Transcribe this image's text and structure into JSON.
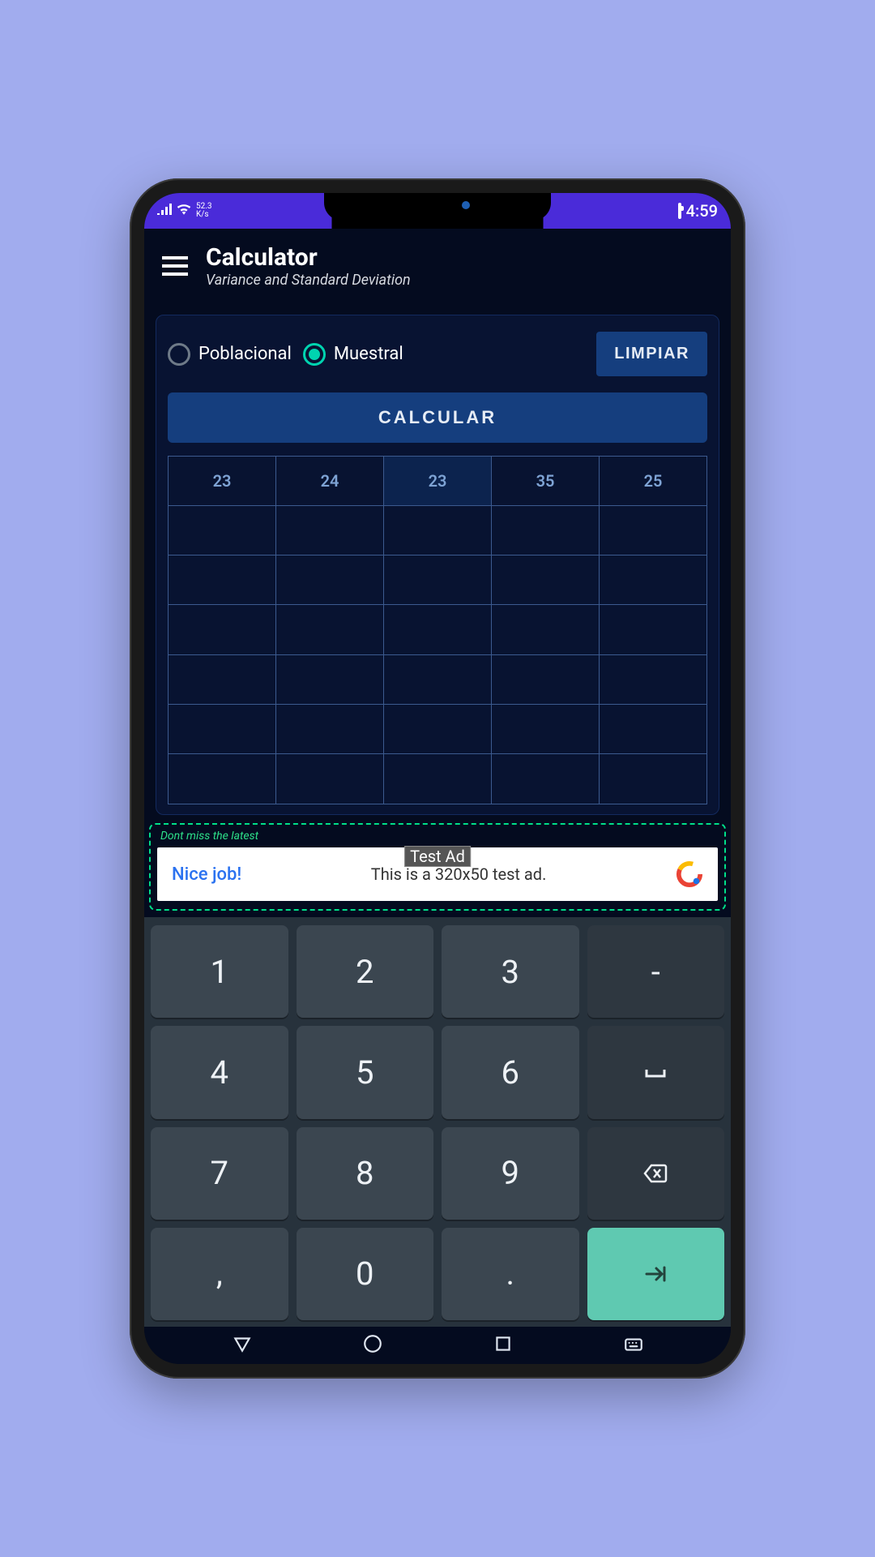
{
  "status": {
    "speed_value": "52.3",
    "speed_unit": "K/s",
    "time": "4:59"
  },
  "header": {
    "title": "Calculator",
    "subtitle": "Variance and Standard Deviation"
  },
  "options": {
    "poblacional": {
      "label": "Poblacional",
      "selected": false
    },
    "muestral": {
      "label": "Muestral",
      "selected": true
    },
    "clear_label": "LIMPIAR",
    "calculate_label": "CALCULAR"
  },
  "grid": {
    "cols": 5,
    "rows": 7,
    "values": [
      "23",
      "24",
      "23",
      "35",
      "25"
    ]
  },
  "ad": {
    "hint": "Dont miss the latest",
    "badge": "Test Ad",
    "left": "Nice job!",
    "mid": "This is a 320x50 test ad."
  },
  "keyboard": {
    "keys": [
      [
        "1",
        "2",
        "3",
        "-"
      ],
      [
        "4",
        "5",
        "6",
        "␣"
      ],
      [
        "7",
        "8",
        "9",
        "⌫"
      ],
      [
        ",",
        "0",
        ".",
        "⇥"
      ]
    ]
  }
}
